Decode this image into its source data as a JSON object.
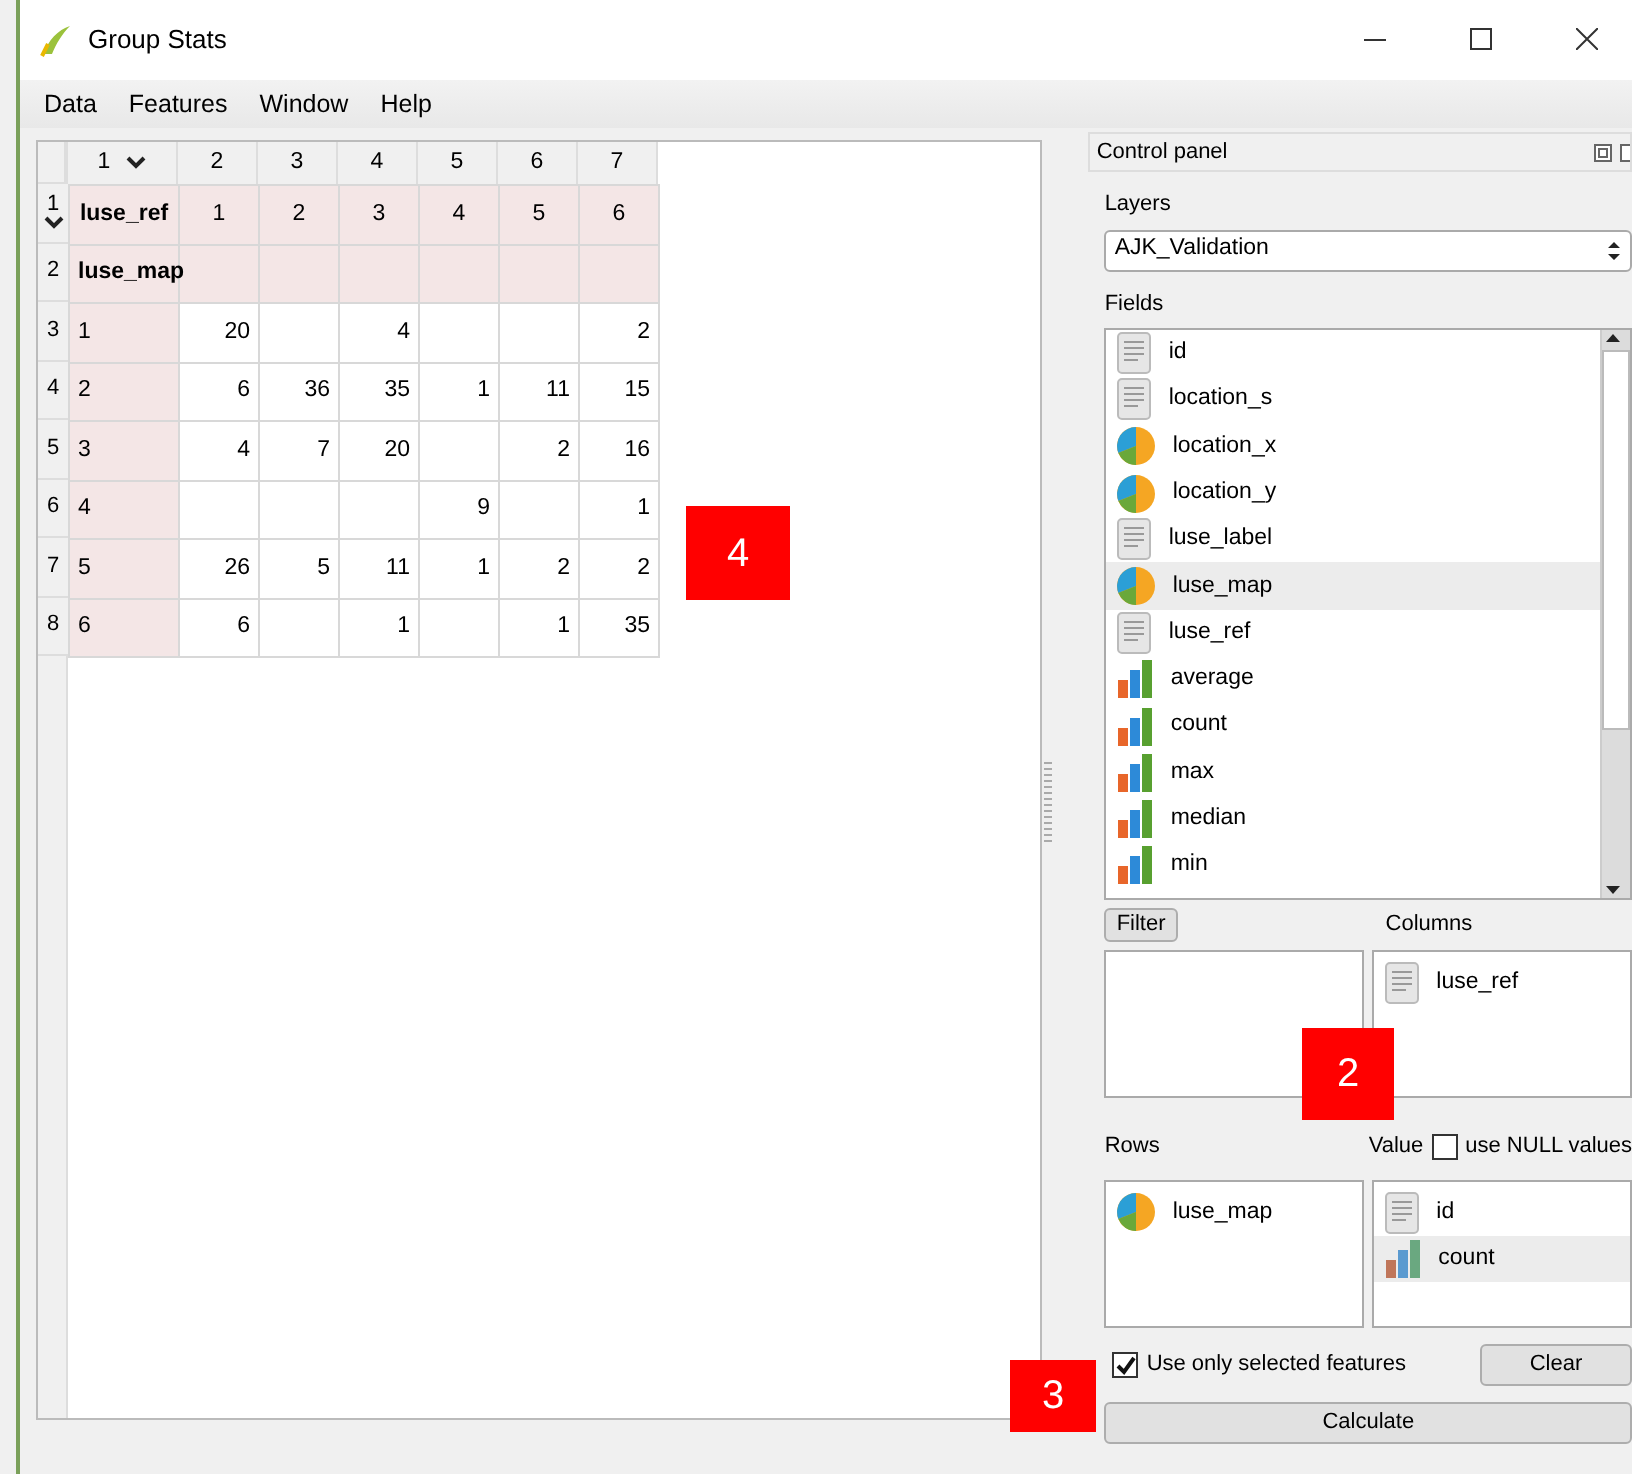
{
  "window": {
    "title": "Group Stats"
  },
  "menu": [
    "Data",
    "Features",
    "Window",
    "Help"
  ],
  "table": {
    "column_headers": [
      {
        "label": "1",
        "menu": true
      },
      {
        "label": "2",
        "menu": false
      },
      {
        "label": "3",
        "menu": false
      },
      {
        "label": "4",
        "menu": false
      },
      {
        "label": "5",
        "menu": false
      },
      {
        "label": "6",
        "menu": false
      },
      {
        "label": "7",
        "menu": false
      }
    ],
    "rows": [
      {
        "header": "1",
        "menu": true,
        "kind": "header",
        "cells": [
          "luse_ref",
          "1",
          "2",
          "3",
          "4",
          "5",
          "6"
        ]
      },
      {
        "header": "2",
        "menu": false,
        "kind": "header",
        "cells": [
          "luse_map",
          "",
          "",
          "",
          "",
          "",
          ""
        ]
      },
      {
        "header": "3",
        "menu": false,
        "kind": "data",
        "cells": [
          "1",
          "20",
          "",
          "4",
          "",
          "",
          "2"
        ]
      },
      {
        "header": "4",
        "menu": false,
        "kind": "data",
        "cells": [
          "2",
          "6",
          "36",
          "35",
          "1",
          "11",
          "15"
        ]
      },
      {
        "header": "5",
        "menu": false,
        "kind": "data",
        "cells": [
          "3",
          "4",
          "7",
          "20",
          "",
          "2",
          "16"
        ]
      },
      {
        "header": "6",
        "menu": false,
        "kind": "data",
        "cells": [
          "4",
          "",
          "",
          "",
          "9",
          "",
          "1"
        ]
      },
      {
        "header": "7",
        "menu": false,
        "kind": "data",
        "cells": [
          "5",
          "26",
          "5",
          "11",
          "1",
          "2",
          "2"
        ]
      },
      {
        "header": "8",
        "menu": false,
        "kind": "data",
        "cells": [
          "6",
          "6",
          "",
          "1",
          "",
          "1",
          "35"
        ]
      }
    ]
  },
  "control_panel": {
    "title": "Control panel",
    "layers_label": "Layers",
    "layer": "AJK_Validation",
    "fields_label": "Fields",
    "fields": [
      {
        "name": "id",
        "kind": "text",
        "selected": false
      },
      {
        "name": "location_s",
        "kind": "text",
        "selected": false
      },
      {
        "name": "location_x",
        "kind": "pie",
        "selected": false
      },
      {
        "name": "location_y",
        "kind": "pie",
        "selected": false
      },
      {
        "name": "luse_label",
        "kind": "text",
        "selected": false
      },
      {
        "name": "luse_map",
        "kind": "pie",
        "selected": true
      },
      {
        "name": "luse_ref",
        "kind": "text",
        "selected": false
      },
      {
        "name": "average",
        "kind": "bar",
        "selected": false
      },
      {
        "name": "count",
        "kind": "bar",
        "selected": false
      },
      {
        "name": "max",
        "kind": "bar",
        "selected": false
      },
      {
        "name": "median",
        "kind": "bar",
        "selected": false
      },
      {
        "name": "min",
        "kind": "bar",
        "selected": false
      }
    ],
    "filter_button": "Filter",
    "columns_label": "Columns",
    "columns": [
      {
        "name": "luse_ref",
        "kind": "text"
      }
    ],
    "rows_label": "Rows",
    "rows": [
      {
        "name": "luse_map",
        "kind": "pie"
      }
    ],
    "value_label": "Value",
    "null_values": {
      "label": "use NULL values",
      "checked": false
    },
    "values": [
      {
        "name": "id",
        "kind": "text",
        "selected": false
      },
      {
        "name": "count",
        "kind": "bar",
        "selected": true
      }
    ],
    "selected_only": {
      "label": "Use only selected features",
      "checked": true
    },
    "clear_button": "Clear",
    "calculate_button": "Calculate"
  },
  "callouts": [
    {
      "label": "4",
      "kind": "table"
    },
    {
      "label": "2",
      "kind": "columns"
    },
    {
      "label": "3",
      "kind": "calculate"
    }
  ]
}
